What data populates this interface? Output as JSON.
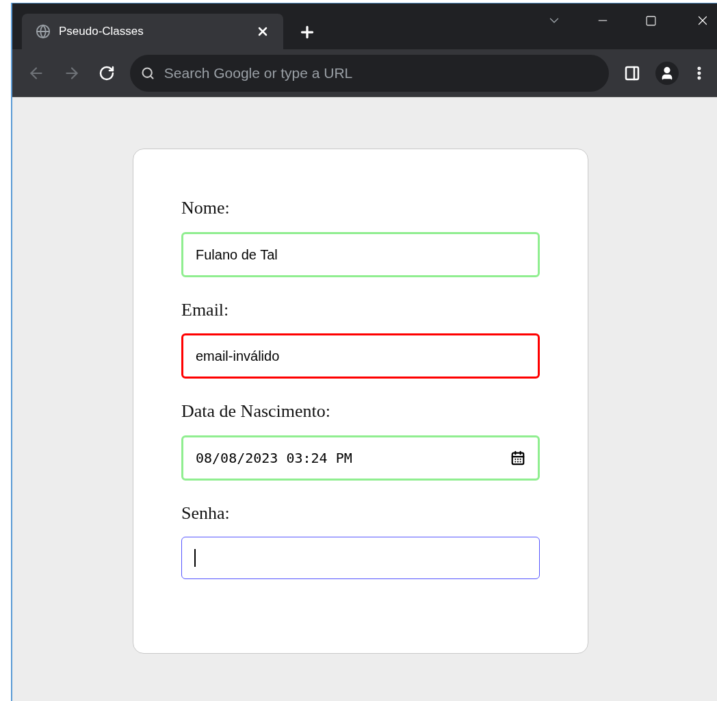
{
  "browser": {
    "tab": {
      "title": "Pseudo-Classes",
      "selected": true
    },
    "omnibox": {
      "placeholder": "Search Google or type a URL"
    }
  },
  "form": {
    "fields": [
      {
        "label": "Nome:",
        "kind": "text",
        "value": "Fulano de Tal",
        "invalid": false,
        "focused": false
      },
      {
        "label": "Email:",
        "kind": "text",
        "value": "email-inválido",
        "invalid": true,
        "focused": false
      },
      {
        "label": "Data de Nascimento:",
        "kind": "datetime",
        "value": "08/08/2023 03:24 PM",
        "invalid": false,
        "focused": false
      },
      {
        "label": "Senha:",
        "kind": "password",
        "invalid": false,
        "focused": true
      }
    ]
  }
}
